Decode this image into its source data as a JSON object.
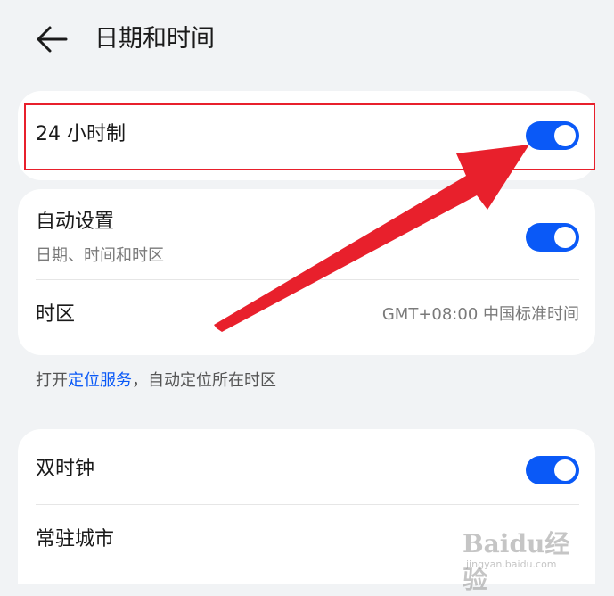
{
  "header": {
    "title": "日期和时间",
    "back_icon": "arrow-left-icon"
  },
  "card_24h": {
    "label": "24 小时制",
    "toggle_on": true
  },
  "card_auto": {
    "auto_label": "自动设置",
    "auto_sub": "日期、时间和时区",
    "auto_toggle_on": true,
    "timezone_label": "时区",
    "timezone_value": "GMT+08:00 中国标准时间"
  },
  "hint": {
    "prefix": "打开",
    "link": "定位服务",
    "suffix": "，自动定位所在时区"
  },
  "card_dual": {
    "dual_label": "双时钟",
    "dual_toggle_on": true,
    "home_city_label": "常驻城市"
  },
  "watermark": {
    "logo": "Baidu经验",
    "site": "jingyan.baidu.com"
  },
  "colors": {
    "accent": "#0a59f7",
    "highlight": "#e8202c",
    "background": "#f1f3f5"
  }
}
